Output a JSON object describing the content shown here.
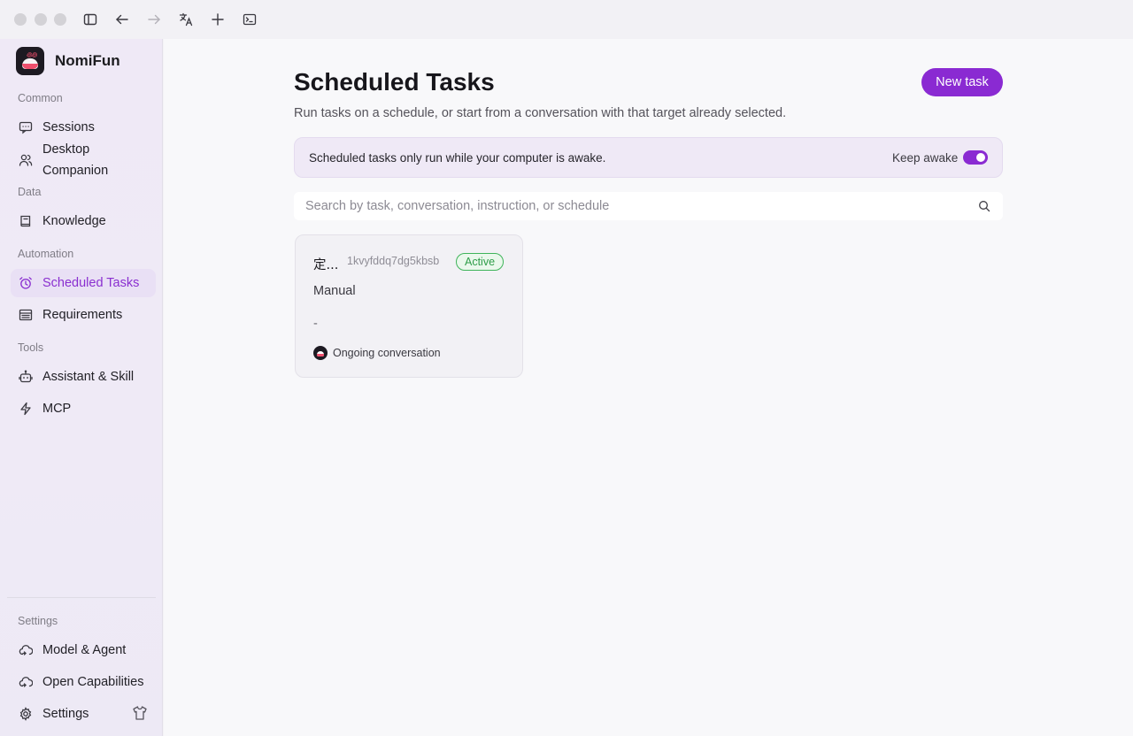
{
  "app": {
    "name": "NomiFun"
  },
  "titlebar": {
    "icons": [
      "sidebar-toggle-icon",
      "back-arrow-icon",
      "forward-arrow-icon",
      "translate-icon",
      "plus-icon",
      "terminal-icon"
    ]
  },
  "sidebar": {
    "sections": {
      "common": "Common",
      "data": "Data",
      "automation": "Automation",
      "tools": "Tools",
      "settings": "Settings"
    },
    "items": {
      "sessions": "Sessions",
      "desktop_companion": "Desktop Companion",
      "knowledge": "Knowledge",
      "scheduled_tasks": "Scheduled Tasks",
      "requirements": "Requirements",
      "assistant_skill": "Assistant & Skill",
      "mcp": "MCP",
      "model_agent": "Model & Agent",
      "open_capabilities": "Open Capabilities",
      "settings": "Settings"
    },
    "active": "scheduled_tasks"
  },
  "main": {
    "title": "Scheduled Tasks",
    "subtitle": "Run tasks on a schedule, or start from a conversation with that target already selected.",
    "new_task_label": "New task",
    "banner": {
      "text": "Scheduled tasks only run while your computer is awake.",
      "keep_awake_label": "Keep awake",
      "keep_awake_on": true
    },
    "search": {
      "placeholder": "Search by task, conversation, instruction, or schedule",
      "value": ""
    },
    "tasks": [
      {
        "title": "定...",
        "id": "1kvyfddq7dg5kbsb",
        "status": "Active",
        "schedule": "Manual",
        "instruction": "-",
        "conversation": "Ongoing conversation"
      }
    ]
  },
  "colors": {
    "accent": "#8a2ad2",
    "active_badge": "#2e9d48",
    "sidebar_bg": "#efe9f6"
  }
}
